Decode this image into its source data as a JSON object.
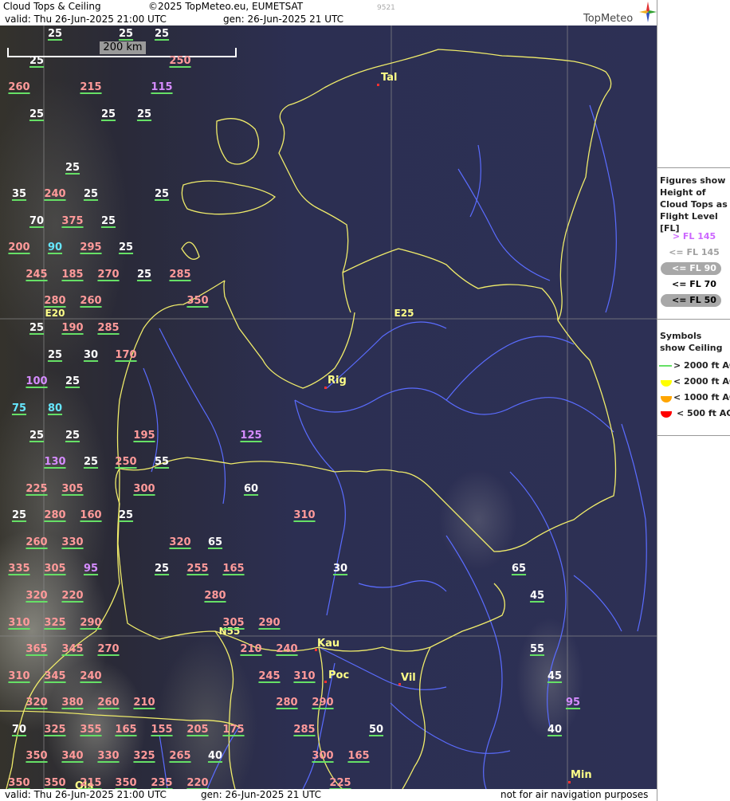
{
  "header": {
    "title": "Cloud Tops & Ceiling",
    "copyright": "©2025 TopMeteo.eu, EUMETSAT",
    "valid": "valid:  Thu  26-Jun-2025  21:00 UTC",
    "gen": "gen: 26-Jun-2025 21 UTC",
    "code": "9521",
    "brand": "TopMeteo"
  },
  "footer": {
    "valid": "valid:  Thu  26-Jun-2025  21:00 UTC",
    "gen": "gen: 26-Jun-2025 21 UTC",
    "disclaimer": "not for air navigation purposes"
  },
  "scale": {
    "label": "200 km"
  },
  "legend": {
    "figures_title": "Figures show Height of Cloud Tops as Flight Level  [FL]",
    "levels": [
      {
        "text": "> FL 145",
        "color": "#ff8080",
        "oval": false
      },
      {
        "text": "<= FL 145",
        "color": "#cc66ff",
        "oval": false
      },
      {
        "text": "<= FL 90",
        "color": "#66e6ff",
        "oval": true
      },
      {
        "text": "<= FL 70",
        "color": "#a0a0a0",
        "oval": false
      },
      {
        "text": "<= FL 50",
        "color": "#ffffff",
        "oval": true
      }
    ],
    "symbols_title": "Symbols show Ceiling",
    "symbols": [
      {
        "text": "> 2000 ft AGL",
        "color": "#66e066",
        "shape": "line"
      },
      {
        "text": "< 2000 ft AGL",
        "color": "#ffff00",
        "shape": "bowl"
      },
      {
        "text": "< 1000 ft AGL",
        "color": "#ffa500",
        "shape": "bowl"
      },
      {
        "text": "< 500 ft AGL",
        "color": "#ff0000",
        "shape": "bowl"
      }
    ]
  },
  "cities": [
    "Tal",
    "Rig",
    "Kau",
    "Poc",
    "Vil",
    "Min",
    "Ols"
  ],
  "coords": [
    "E20",
    "E25",
    "N55"
  ],
  "cloud_tops": [
    {
      "v": "25",
      "c": "white"
    },
    {
      "v": "25",
      "c": "white"
    },
    {
      "v": "25",
      "c": "white"
    },
    {
      "v": "25",
      "c": "white"
    },
    {
      "v": "250",
      "c": "red"
    },
    {
      "v": "260",
      "c": "red"
    },
    {
      "v": "215",
      "c": "red"
    },
    {
      "v": "115",
      "c": "purple"
    },
    {
      "v": "25",
      "c": "white"
    },
    {
      "v": "25",
      "c": "white"
    },
    {
      "v": "25",
      "c": "white"
    },
    {
      "v": "25",
      "c": "white"
    },
    {
      "v": "35",
      "c": "white"
    },
    {
      "v": "240",
      "c": "red"
    },
    {
      "v": "25",
      "c": "white"
    },
    {
      "v": "25",
      "c": "white"
    },
    {
      "v": "70",
      "c": "white"
    },
    {
      "v": "375",
      "c": "red"
    },
    {
      "v": "25",
      "c": "white"
    },
    {
      "v": "200",
      "c": "red"
    },
    {
      "v": "90",
      "c": "cyan"
    },
    {
      "v": "295",
      "c": "red"
    },
    {
      "v": "25",
      "c": "white"
    },
    {
      "v": "245",
      "c": "red"
    },
    {
      "v": "185",
      "c": "red"
    },
    {
      "v": "270",
      "c": "red"
    },
    {
      "v": "25",
      "c": "white"
    },
    {
      "v": "285",
      "c": "red"
    },
    {
      "v": "280",
      "c": "red"
    },
    {
      "v": "260",
      "c": "red"
    },
    {
      "v": "350",
      "c": "red"
    },
    {
      "v": "25",
      "c": "white"
    },
    {
      "v": "190",
      "c": "red"
    },
    {
      "v": "285",
      "c": "red"
    },
    {
      "v": "25",
      "c": "white"
    },
    {
      "v": "30",
      "c": "white"
    },
    {
      "v": "170",
      "c": "red"
    },
    {
      "v": "100",
      "c": "purple"
    },
    {
      "v": "25",
      "c": "white"
    },
    {
      "v": "75",
      "c": "cyan"
    },
    {
      "v": "80",
      "c": "cyan"
    },
    {
      "v": "25",
      "c": "white"
    },
    {
      "v": "25",
      "c": "white"
    },
    {
      "v": "195",
      "c": "red"
    },
    {
      "v": "125",
      "c": "purple"
    },
    {
      "v": "130",
      "c": "purple"
    },
    {
      "v": "25",
      "c": "white"
    },
    {
      "v": "250",
      "c": "red"
    },
    {
      "v": "55",
      "c": "white"
    },
    {
      "v": "225",
      "c": "red"
    },
    {
      "v": "305",
      "c": "red"
    },
    {
      "v": "300",
      "c": "red"
    },
    {
      "v": "60",
      "c": "white"
    },
    {
      "v": "25",
      "c": "white"
    },
    {
      "v": "280",
      "c": "red"
    },
    {
      "v": "160",
      "c": "red"
    },
    {
      "v": "25",
      "c": "white"
    },
    {
      "v": "310",
      "c": "red"
    },
    {
      "v": "260",
      "c": "red"
    },
    {
      "v": "330",
      "c": "red"
    },
    {
      "v": "320",
      "c": "red"
    },
    {
      "v": "65",
      "c": "white"
    },
    {
      "v": "335",
      "c": "red"
    },
    {
      "v": "305",
      "c": "red"
    },
    {
      "v": "95",
      "c": "purple"
    },
    {
      "v": "25",
      "c": "white"
    },
    {
      "v": "255",
      "c": "red"
    },
    {
      "v": "165",
      "c": "red"
    },
    {
      "v": "30",
      "c": "white"
    },
    {
      "v": "65",
      "c": "white"
    },
    {
      "v": "320",
      "c": "red"
    },
    {
      "v": "220",
      "c": "red"
    },
    {
      "v": "280",
      "c": "red"
    },
    {
      "v": "45",
      "c": "white"
    },
    {
      "v": "310",
      "c": "red"
    },
    {
      "v": "325",
      "c": "red"
    },
    {
      "v": "290",
      "c": "red"
    },
    {
      "v": "305",
      "c": "red"
    },
    {
      "v": "290",
      "c": "red"
    },
    {
      "v": "365",
      "c": "red"
    },
    {
      "v": "345",
      "c": "red"
    },
    {
      "v": "270",
      "c": "red"
    },
    {
      "v": "210",
      "c": "red"
    },
    {
      "v": "240",
      "c": "red"
    },
    {
      "v": "55",
      "c": "white"
    },
    {
      "v": "310",
      "c": "red"
    },
    {
      "v": "345",
      "c": "red"
    },
    {
      "v": "240",
      "c": "red"
    },
    {
      "v": "245",
      "c": "red"
    },
    {
      "v": "310",
      "c": "red"
    },
    {
      "v": "45",
      "c": "white"
    },
    {
      "v": "320",
      "c": "red"
    },
    {
      "v": "380",
      "c": "red"
    },
    {
      "v": "260",
      "c": "red"
    },
    {
      "v": "210",
      "c": "red"
    },
    {
      "v": "280",
      "c": "red"
    },
    {
      "v": "290",
      "c": "red"
    },
    {
      "v": "95",
      "c": "purple"
    },
    {
      "v": "70",
      "c": "white"
    },
    {
      "v": "325",
      "c": "red"
    },
    {
      "v": "355",
      "c": "red"
    },
    {
      "v": "165",
      "c": "red"
    },
    {
      "v": "155",
      "c": "red"
    },
    {
      "v": "205",
      "c": "red"
    },
    {
      "v": "175",
      "c": "red"
    },
    {
      "v": "285",
      "c": "red"
    },
    {
      "v": "50",
      "c": "white"
    },
    {
      "v": "40",
      "c": "white"
    },
    {
      "v": "350",
      "c": "red"
    },
    {
      "v": "340",
      "c": "red"
    },
    {
      "v": "330",
      "c": "red"
    },
    {
      "v": "325",
      "c": "red"
    },
    {
      "v": "265",
      "c": "red"
    },
    {
      "v": "40",
      "c": "white"
    },
    {
      "v": "300",
      "c": "red"
    },
    {
      "v": "165",
      "c": "red"
    },
    {
      "v": "350",
      "c": "red"
    },
    {
      "v": "350",
      "c": "red"
    },
    {
      "v": "215",
      "c": "red"
    },
    {
      "v": "350",
      "c": "red"
    },
    {
      "v": "235",
      "c": "red"
    },
    {
      "v": "220",
      "c": "red"
    },
    {
      "v": "225",
      "c": "red"
    }
  ]
}
